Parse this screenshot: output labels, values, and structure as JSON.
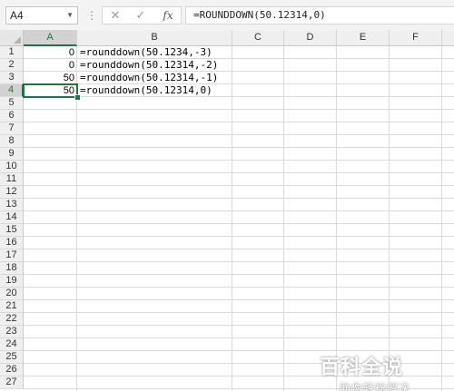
{
  "formula_bar": {
    "name_box": "A4",
    "name_box_dropdown_icon": "chevron-down-icon",
    "cancel_icon": "✕",
    "enter_icon": "✓",
    "function_icon": "fx",
    "formula": "=ROUNDDOWN(50.12314,0)"
  },
  "columns": [
    "A",
    "B",
    "C",
    "D",
    "E",
    "F"
  ],
  "active_column": "A",
  "rows": [
    "1",
    "2",
    "3",
    "4",
    "5",
    "6",
    "7",
    "8",
    "9",
    "10",
    "11",
    "12",
    "13",
    "14",
    "15",
    "16",
    "17",
    "18",
    "19",
    "20",
    "21",
    "22",
    "23",
    "24",
    "25",
    "26",
    "27"
  ],
  "active_row": "4",
  "cells": {
    "A1": "0",
    "B1": "=rounddown(50.1234,-3)",
    "A2": "0",
    "B2": "=rounddown(50.12314,-2)",
    "A3": "50",
    "B3": "=rounddown(50.12314,-1)",
    "A4": "50",
    "B4": "=rounddown(50.12314,0)"
  },
  "watermark": {
    "title": "百科全说",
    "subtitle": "助你轻松解决"
  },
  "colors": {
    "accent": "#217346",
    "header_bg": "#efefef",
    "gridline": "#dadada"
  }
}
